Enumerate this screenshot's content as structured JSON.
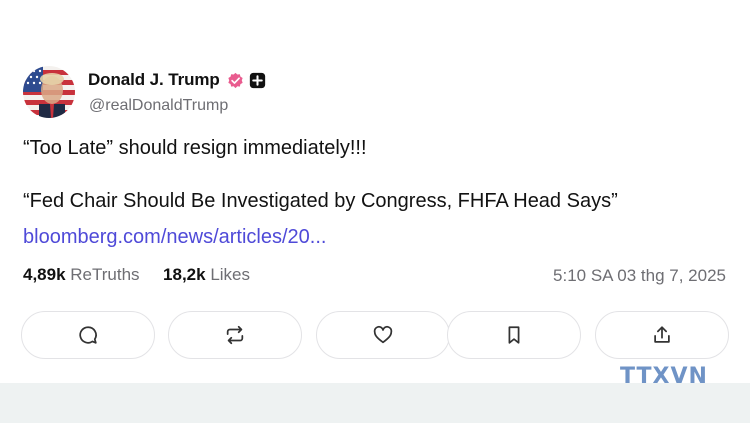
{
  "post": {
    "author": {
      "display_name": "Donald J. Trump",
      "handle": "@realDonaldTrump",
      "avatar_icon": "flag-portrait-avatar",
      "verified_icon": "verified-check-icon",
      "badge_icon": "plus-badge-icon"
    },
    "text_line_1": "“Too Late” should resign immediately!!!",
    "text_line_2": "“Fed Chair Should Be Investigated by Congress, FHFA Head Says”",
    "link": "bloomberg.com/news/articles/20...",
    "stats": {
      "retruths_count": "4,89k",
      "retruths_label": "ReTruths",
      "likes_count": "18,2k",
      "likes_label": "Likes"
    },
    "timestamp": "5:10 SA 03 thg 7, 2025",
    "actions": [
      {
        "name": "reply-button",
        "icon": "comment-icon"
      },
      {
        "name": "retruth-button",
        "icon": "repost-icon"
      },
      {
        "name": "like-button",
        "icon": "heart-icon"
      },
      {
        "name": "bookmark-button",
        "icon": "bookmark-icon"
      },
      {
        "name": "share-button",
        "icon": "share-icon"
      }
    ]
  },
  "watermark": "TTXVN",
  "colors": {
    "link": "#4f4ad8",
    "verified_badge": "#e95c8f",
    "muted_text": "#6e6e73",
    "bottom_band": "#eef2f2",
    "watermark": "#6f93c6"
  }
}
